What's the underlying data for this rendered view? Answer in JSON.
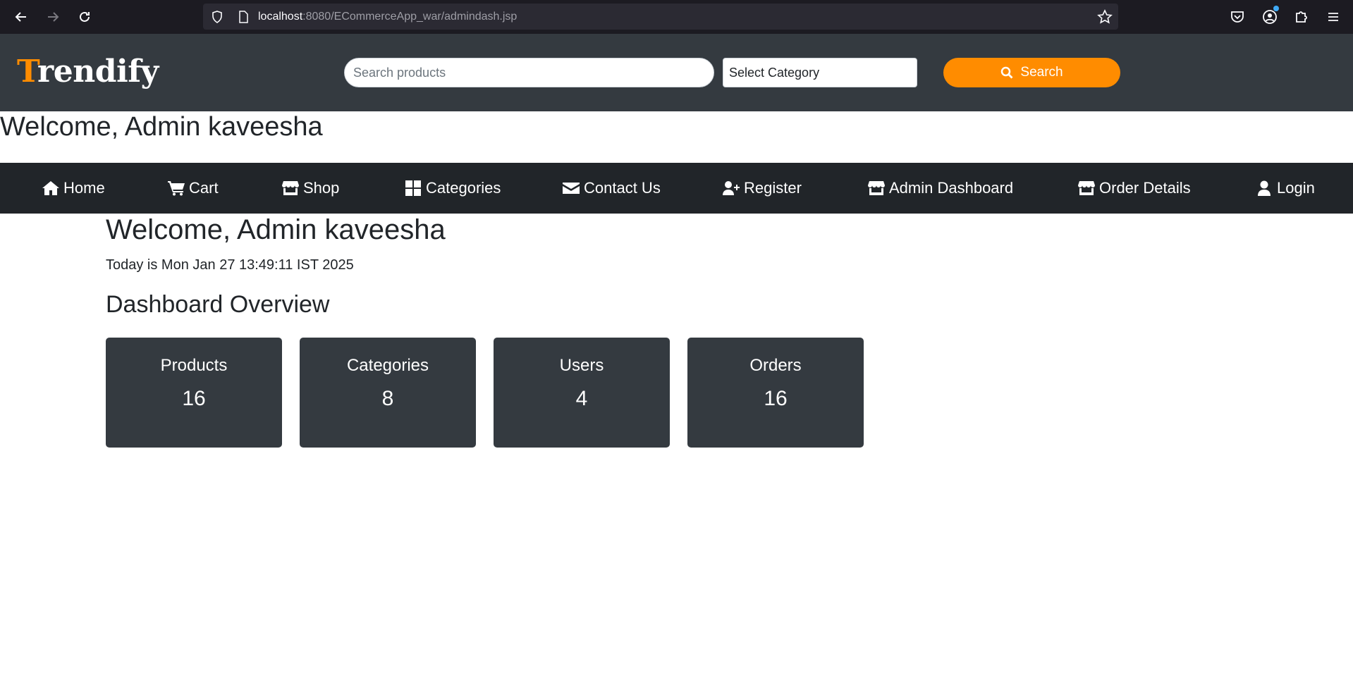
{
  "browser": {
    "url_host": "localhost",
    "url_path": ":8080/ECommerceApp_war/admindash.jsp"
  },
  "header": {
    "logo_first": "T",
    "logo_rest": "rendify",
    "search_placeholder": "Search products",
    "category_selected": "Select Category",
    "search_button": "Search"
  },
  "welcome_banner": "Welcome, Admin kaveesha",
  "nav": {
    "items": [
      {
        "label": "Home",
        "icon": "home-icon"
      },
      {
        "label": "Cart",
        "icon": "cart-icon"
      },
      {
        "label": "Shop",
        "icon": "store-icon"
      },
      {
        "label": "Categories",
        "icon": "grid-icon"
      },
      {
        "label": "Contact Us",
        "icon": "envelope-icon"
      },
      {
        "label": "Register",
        "icon": "user-plus-icon"
      },
      {
        "label": "Admin Dashboard",
        "icon": "store-icon"
      },
      {
        "label": "Order Details",
        "icon": "store-icon"
      },
      {
        "label": "Login",
        "icon": "user-icon"
      }
    ]
  },
  "content": {
    "title": "Welcome, Admin kaveesha",
    "today": "Today is Mon Jan 27 13:49:11 IST 2025",
    "overview_title": "Dashboard Overview",
    "stats": [
      {
        "label": "Products",
        "value": "16"
      },
      {
        "label": "Categories",
        "value": "8"
      },
      {
        "label": "Users",
        "value": "4"
      },
      {
        "label": "Orders",
        "value": "16"
      }
    ]
  },
  "colors": {
    "accent": "#ff8c00",
    "header_bg": "#343a40",
    "nav_bg": "#212529",
    "card_bg": "#343a40"
  }
}
